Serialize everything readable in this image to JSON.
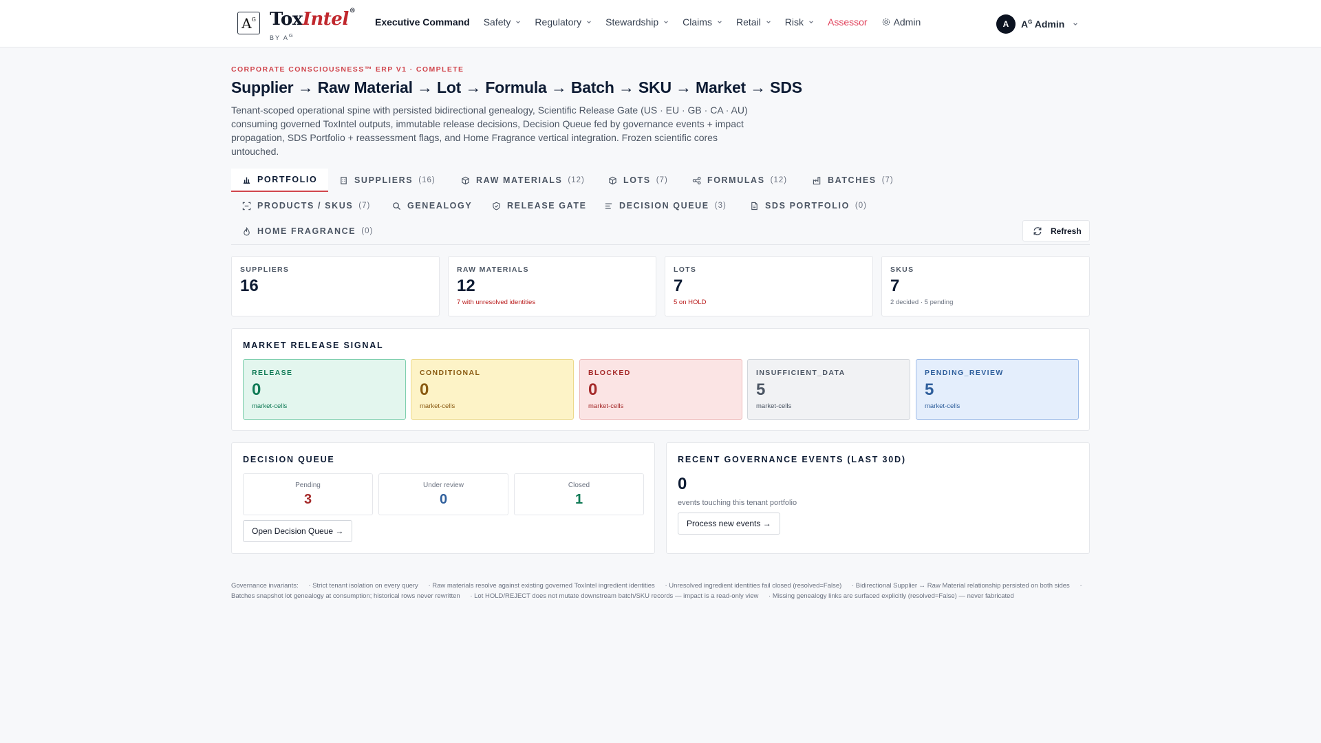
{
  "brand": {
    "mark": "A",
    "mark_sup": "G",
    "name_main": "Tox",
    "name_accent": "Intel",
    "name_reg": "®",
    "byline": "BY A",
    "byline_sup": "G"
  },
  "nav": {
    "items": [
      {
        "label": "Executive Command",
        "icon": "",
        "dropdown": false
      },
      {
        "label": "Safety",
        "dropdown": true
      },
      {
        "label": "Regulatory",
        "dropdown": true
      },
      {
        "label": "Stewardship",
        "dropdown": true
      },
      {
        "label": "Claims",
        "dropdown": true
      },
      {
        "label": "Retail",
        "dropdown": true
      },
      {
        "label": "Risk",
        "dropdown": true
      },
      {
        "label": "Assessor",
        "dropdown": false
      },
      {
        "label": "Admin",
        "icon": "gear-icon",
        "dropdown": false
      }
    ],
    "user": {
      "initial": "A",
      "name": "A",
      "name_sup": "G",
      "name_rest": " Admin"
    }
  },
  "header": {
    "eyebrow": "CORPORATE CONSCIOUSNESS™ ERP V1 · COMPLETE",
    "title": "Supplier → Raw Material → Lot → Formula → Batch → SKU → Market → SDS",
    "description": "Tenant-scoped operational spine with persisted bidirectional genealogy, Scientific Release Gate (US · EU · GB · CA · AU) consuming governed ToxIntel outputs, immutable release decisions, Decision Queue fed by governance events + impact propagation, SDS Portfolio + reassessment flags, and Home Fragrance vertical integration. Frozen scientific cores untouched."
  },
  "tabs": [
    {
      "label": "PORTFOLIO",
      "count": "",
      "icon": "bar-chart-icon"
    },
    {
      "label": "SUPPLIERS",
      "count": "(16)",
      "icon": "building-icon"
    },
    {
      "label": "RAW MATERIALS",
      "count": "(12)",
      "icon": "package-icon"
    },
    {
      "label": "LOTS",
      "count": "(7)",
      "icon": "box-icon"
    },
    {
      "label": "FORMULAS",
      "count": "(12)",
      "icon": "network-icon"
    },
    {
      "label": "BATCHES",
      "count": "(7)",
      "icon": "factory-icon"
    },
    {
      "label": "PRODUCTS / SKUS",
      "count": "(7)",
      "icon": "scan-icon"
    },
    {
      "label": "GENEALOGY",
      "count": "",
      "icon": "search-icon"
    },
    {
      "label": "RELEASE GATE",
      "count": "",
      "icon": "shield-check-icon"
    },
    {
      "label": "DECISION QUEUE",
      "count": "(3)",
      "icon": "list-icon"
    },
    {
      "label": "SDS PORTFOLIO",
      "count": "(0)",
      "icon": "document-icon"
    },
    {
      "label": "HOME FRAGRANCE",
      "count": "(0)",
      "icon": "flame-icon"
    }
  ],
  "refresh_label": "Refresh",
  "stats": [
    {
      "label": "SUPPLIERS",
      "value": "16",
      "sub": ""
    },
    {
      "label": "RAW MATERIALS",
      "value": "12",
      "sub": "7 with unresolved identities"
    },
    {
      "label": "LOTS",
      "value": "7",
      "sub": "5 on HOLD"
    },
    {
      "label": "SKUS",
      "value": "7",
      "sub": "2 decided · 5 pending"
    }
  ],
  "market_signal": {
    "title": "MARKET RELEASE SIGNAL",
    "tiles": [
      {
        "label": "RELEASE",
        "value": "0",
        "sub": "market-cells",
        "color": "#0f7a55",
        "bg": "#e3f6ee",
        "border": "#7fcfae"
      },
      {
        "label": "CONDITIONAL",
        "value": "0",
        "sub": "market-cells",
        "color": "#8a5a12",
        "bg": "#fdf3c7",
        "border": "#ecd98a"
      },
      {
        "label": "BLOCKED",
        "value": "0",
        "sub": "market-cells",
        "color": "#a52a2a",
        "bg": "#fbe4e4",
        "border": "#eeb9b9"
      },
      {
        "label": "INSUFFICIENT_DATA",
        "value": "5",
        "sub": "market-cells",
        "color": "#4b5563",
        "bg": "#f1f2f4",
        "border": "#d1d5db"
      },
      {
        "label": "PENDING_REVIEW",
        "value": "5",
        "sub": "market-cells",
        "color": "#2f5f9c",
        "bg": "#e4eefc",
        "border": "#9dbbe8"
      }
    ]
  },
  "decision_queue": {
    "title": "DECISION QUEUE",
    "boxes": [
      {
        "label": "Pending",
        "value": "3",
        "color": "#a52a2a"
      },
      {
        "label": "Under review",
        "value": "0",
        "color": "#2f5f9c"
      },
      {
        "label": "Closed",
        "value": "1",
        "color": "#0f7a55"
      }
    ],
    "button": "Open Decision Queue →"
  },
  "governance": {
    "title": "RECENT GOVERNANCE EVENTS (LAST 30D)",
    "value": "0",
    "sub": "events touching this tenant portfolio",
    "button": "Process new events →"
  },
  "invariants": {
    "lead": "Governance invariants:",
    "items": [
      "· Strict tenant isolation on every query",
      "· Raw materials resolve against existing governed ToxIntel ingredient identities",
      "· Unresolved ingredient identities fail closed (resolved=False)",
      "· Bidirectional Supplier ↔ Raw Material relationship persisted on both sides",
      "· Batches snapshot lot genealogy at consumption; historical rows never rewritten",
      "· Lot HOLD/REJECT does not mutate downstream batch/SKU records — impact is a read-only view",
      "· Missing genealogy links are surfaced explicitly (resolved=False) — never fabricated"
    ]
  }
}
